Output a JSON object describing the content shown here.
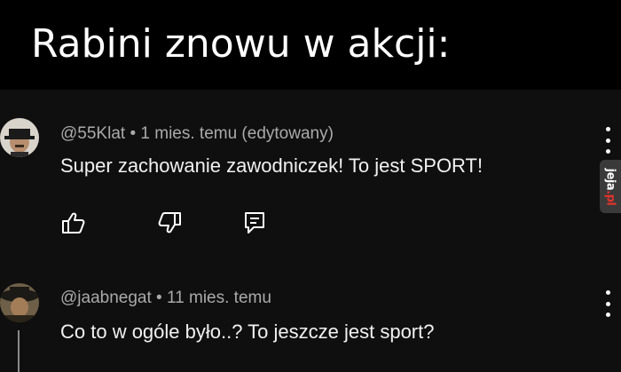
{
  "meme_title": "Rabini znowu w akcji:",
  "comments": [
    {
      "handle": "@55Klat",
      "separator": "•",
      "time": "1 mies. temu (edytowany)",
      "text": "Super zachowanie zawodniczek! To jest SPORT!"
    },
    {
      "handle": "@jaabnegat",
      "separator": "•",
      "time": "11 mies. temu",
      "text": "Co to w ogóle było..? To jeszcze jest sport?"
    }
  ],
  "icons": {
    "like": "thumbs-up-icon",
    "dislike": "thumbs-down-icon",
    "reply": "reply-icon",
    "more": "more-vertical-icon"
  },
  "watermark": {
    "main": "jeja",
    "suffix": ".pl"
  },
  "colors": {
    "title_background": "#000000",
    "comments_background": "#0f0f0f",
    "meta_text": "#aaaaaa",
    "body_text": "#f1f1f1",
    "watermark_accent": "#e0342c"
  }
}
